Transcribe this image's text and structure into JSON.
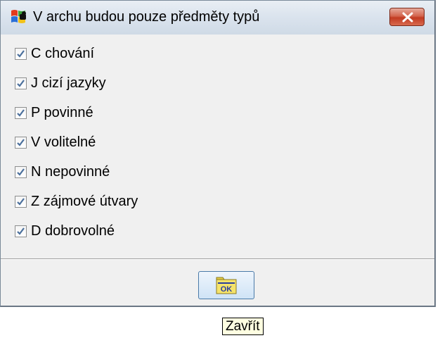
{
  "dialog": {
    "title": "V archu budou pouze předměty typů",
    "icons": {
      "app": "windows-flag-icon",
      "close": "close-icon"
    }
  },
  "options": [
    {
      "label": "C chování",
      "checked": true
    },
    {
      "label": "J cizí jazyky",
      "checked": true
    },
    {
      "label": "P povinné",
      "checked": true
    },
    {
      "label": "V volitelné",
      "checked": true
    },
    {
      "label": "N nepovinné",
      "checked": true
    },
    {
      "label": "Z zájmové útvary",
      "checked": true
    },
    {
      "label": "D dobrovolné",
      "checked": true
    }
  ],
  "ok_button": {
    "label": "OK",
    "icon": "ok-folder-icon"
  },
  "tooltip": {
    "text": "Zavřít"
  },
  "colors": {
    "close_button": "#c9452c",
    "window_bg": "#f0f0f0",
    "tooltip_bg": "#ffffe1"
  }
}
